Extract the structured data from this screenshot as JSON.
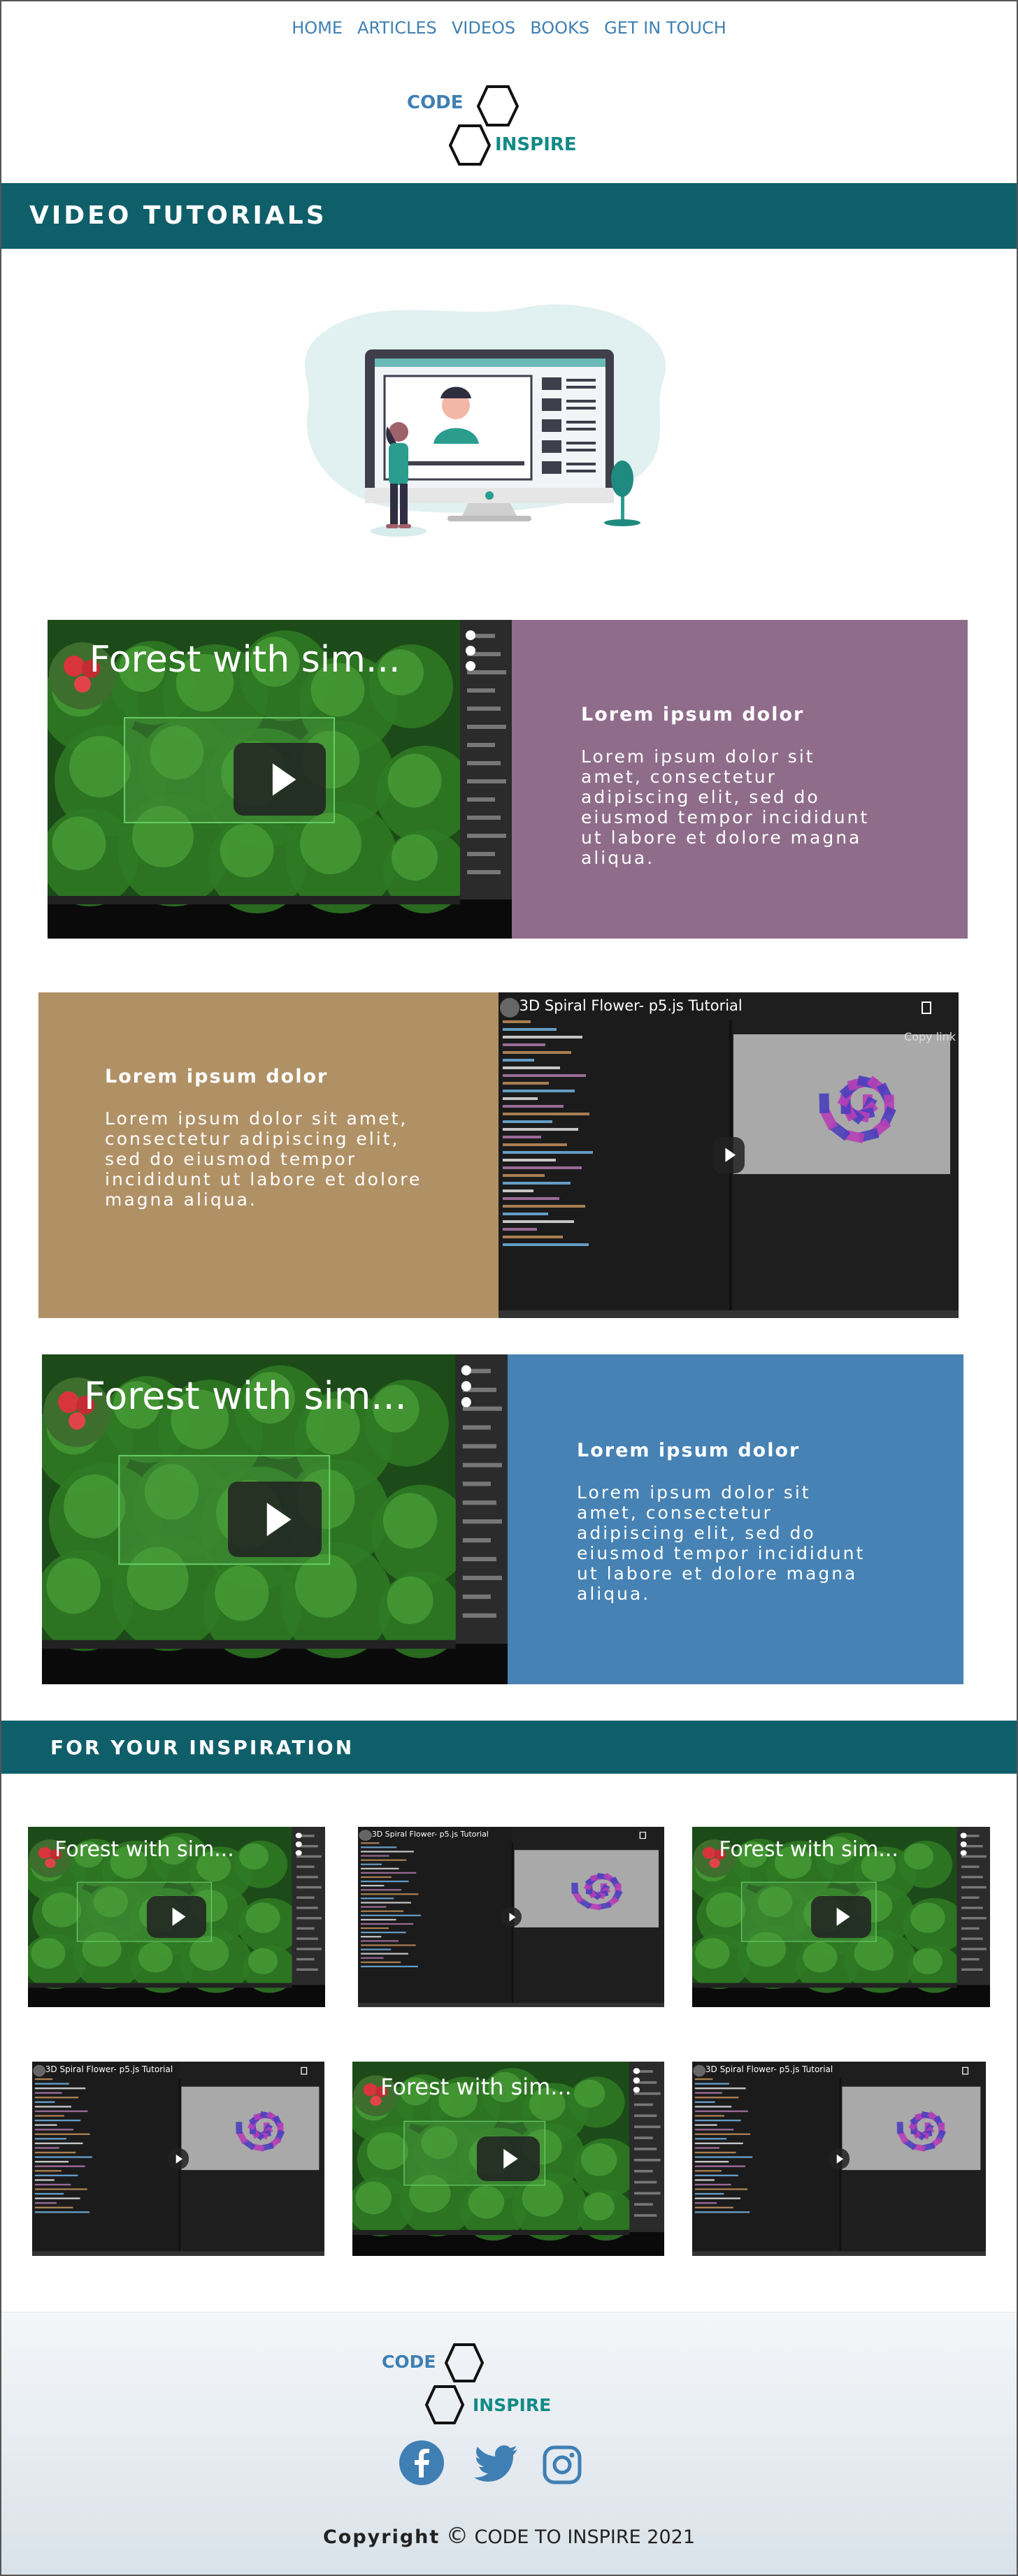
{
  "nav": {
    "items": [
      "HOME",
      "ARTICLES",
      "VIDEOS",
      "BOOKS",
      "GET IN TOUCH"
    ]
  },
  "logo": {
    "code": "CODE",
    "inspire": "INSPIRE"
  },
  "sections": {
    "video_tutorials": "VIDEO  TUTORIALS",
    "inspiration": "FOR YOUR INSPIRATION"
  },
  "feature_cards": [
    {
      "heading": "Lorem ipsum dolor",
      "body": "Lorem ipsum dolor sit amet, consectetur adipiscing elit, sed do eiusmod tempor incididunt ut labore et dolore magna aliqua.",
      "color": "#8f6d8a",
      "video_title": "Forest with sim..."
    },
    {
      "heading": "Lorem ipsum dolor",
      "body": "Lorem ipsum dolor sit amet, consectetur adipiscing elit, sed do eiusmod tempor incididunt ut labore et dolore magna aliqua.",
      "color": "#b09166",
      "video_title": "3D Spiral Flower- p5.js Tutorial",
      "video_copy_label": "Copy link"
    },
    {
      "heading": "Lorem ipsum dolor",
      "body": "Lorem ipsum dolor sit amet, consectetur adipiscing elit, sed do eiusmod tempor incididunt ut labore et dolore magna aliqua.",
      "color": "#4682b4",
      "video_title": "Forest with sim..."
    }
  ],
  "inspiration_videos": [
    {
      "title": "Forest with sim...",
      "kind": "forest"
    },
    {
      "title": "3D Spiral Flower- p5.js Tutorial",
      "kind": "spiral"
    },
    {
      "title": "Forest with sim...",
      "kind": "forest"
    },
    {
      "title": "3D Spiral Flower- p5.js Tutorial",
      "kind": "spiral"
    },
    {
      "title": "Forest with sim...",
      "kind": "forest"
    },
    {
      "title": "3D Spiral Flower- p5.js Tutorial",
      "kind": "spiral"
    }
  ],
  "footer": {
    "copyright_label": "Copyright",
    "copyright_symbol": "©",
    "copyright_text": "CODE TO INSPIRE  2021",
    "social": [
      "facebook-icon",
      "twitter-icon",
      "instagram-icon"
    ]
  },
  "colors": {
    "nav_link": "#3f7fb3",
    "banner": "#0f5f6a",
    "logo_code": "#3f7fb3",
    "logo_inspire": "#138a86",
    "social_icon": "#3f7fb3"
  }
}
